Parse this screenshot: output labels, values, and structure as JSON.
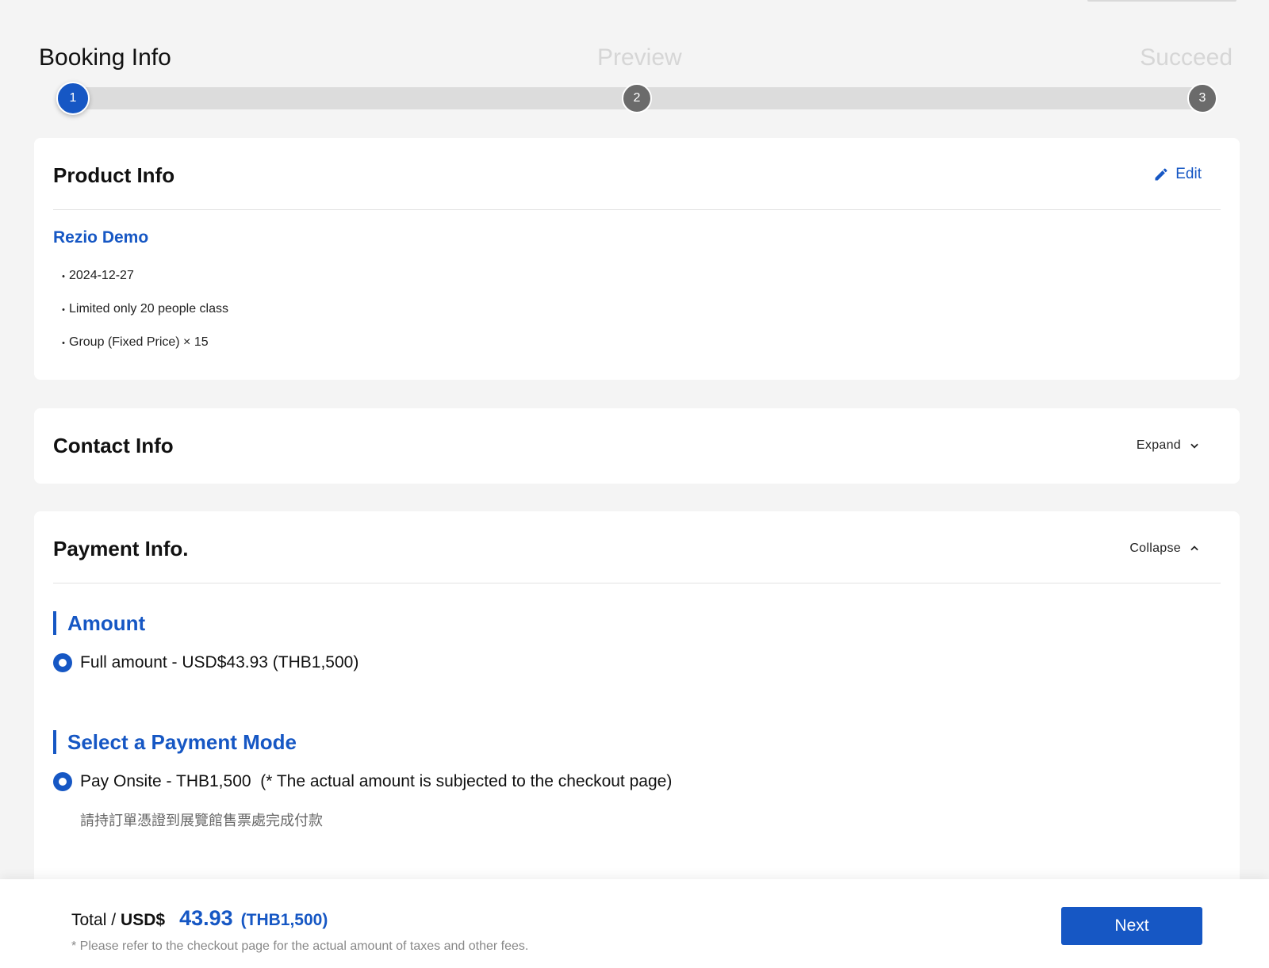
{
  "stepper": {
    "steps": [
      {
        "label": "Booking Info",
        "number": "1",
        "state": "active"
      },
      {
        "label": "Preview",
        "number": "2",
        "state": "inactive"
      },
      {
        "label": "Succeed",
        "number": "3",
        "state": "inactive"
      }
    ]
  },
  "product_info": {
    "title": "Product Info",
    "edit_label": "Edit",
    "edit_icon": "pencil-icon",
    "product_name": "Rezio Demo",
    "details": [
      "2024-12-27",
      "Limited only 20 people class",
      "Group (Fixed Price) × 15"
    ],
    "bullet": "・"
  },
  "contact_info": {
    "title": "Contact Info",
    "toggle_label": "Expand",
    "toggle_icon": "chevron-down-icon"
  },
  "payment_info": {
    "title": "Payment Info.",
    "toggle_label": "Collapse",
    "toggle_icon": "chevron-up-icon",
    "amount_heading": "Amount",
    "amount_option": "Full amount - USD$43.93 (THB1,500)",
    "mode_heading": "Select a Payment Mode",
    "mode_option": "Pay Onsite - THB1,500  (* The actual amount is subjected to the checkout page)",
    "mode_note": "請持訂單憑證到展覽館售票處完成付款"
  },
  "footer": {
    "total_label": "Total /",
    "total_currency": "USD$",
    "total_amount": "43.93",
    "total_local": "(THB1,500)",
    "note": "* Please refer to the checkout page for the actual amount of taxes and other fees.",
    "next_label": "Next"
  },
  "colors": {
    "accent": "#1657c4",
    "background": "#f4f4f4",
    "inactive_step": "#6b6b6b"
  }
}
